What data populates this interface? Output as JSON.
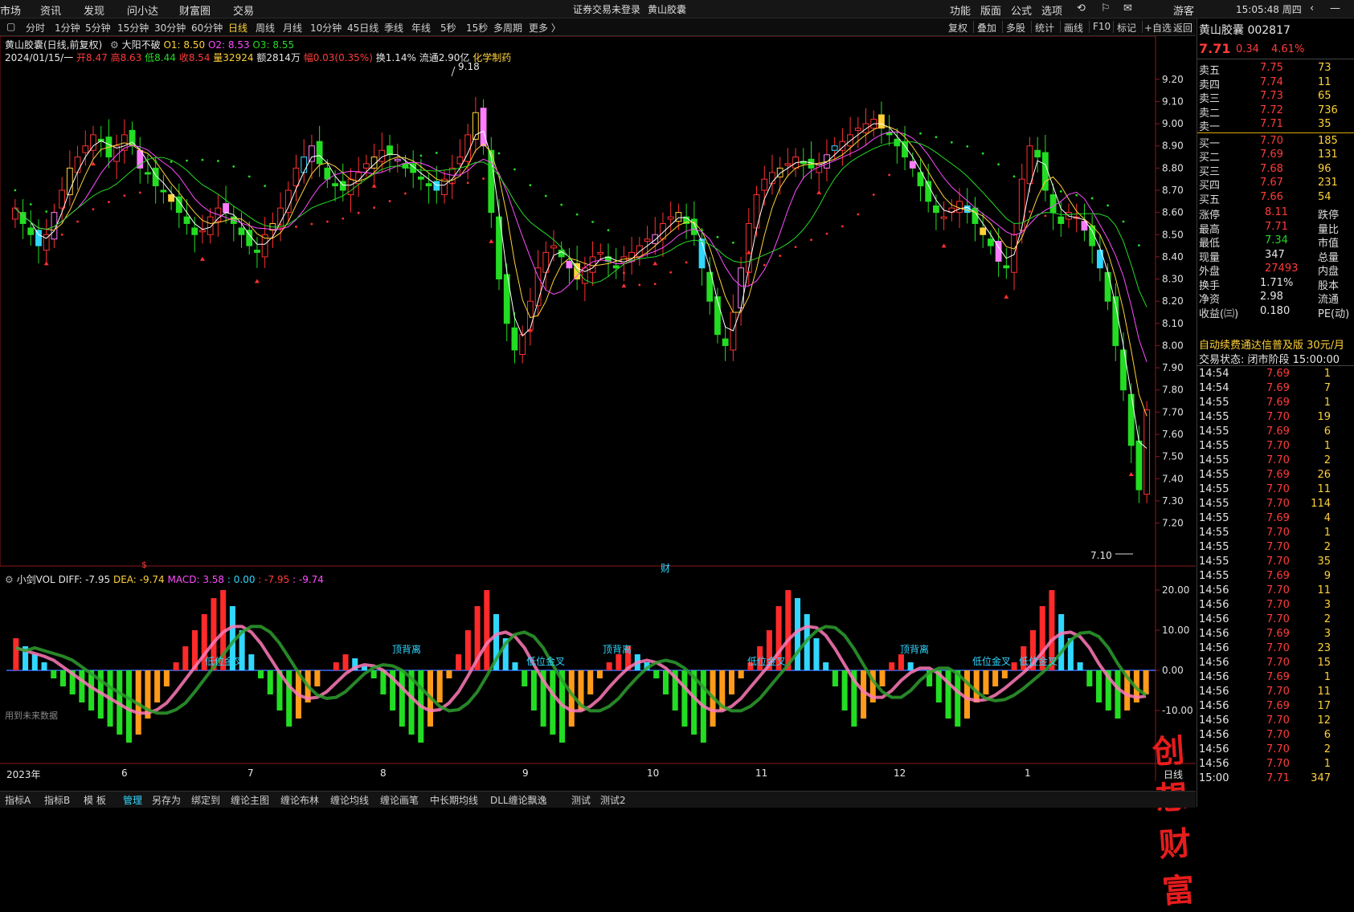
{
  "menu": {
    "items": [
      "市场",
      "资讯",
      "发现",
      "问小达",
      "财富圈",
      "交易"
    ],
    "notice": "证券交易未登录",
    "stock_link": "黄山胶囊",
    "right_items": [
      "功能",
      "版面",
      "公式",
      "选项"
    ],
    "guest": "游客",
    "clock": "15:05:48 周四"
  },
  "toolbar": {
    "periods": [
      "分时",
      "1分钟",
      "5分钟",
      "15分钟",
      "30分钟",
      "60分钟",
      "日线",
      "周线",
      "月线",
      "10分钟",
      "45日线",
      "季线",
      "年线",
      "5秒",
      "15秒",
      "多周期",
      "更多 〉"
    ],
    "active": "日线",
    "right": [
      "复权",
      "叠加",
      "多股",
      "统计",
      "画线",
      "F10",
      "标记",
      "+自选",
      "返回"
    ]
  },
  "main": {
    "title": "黄山胶囊(日线,前复权)",
    "indicator_name": "大阳不破",
    "o1": "O1: 8.50",
    "o2": "O2: 8.53",
    "o3": "O3: 8.55",
    "date": "2024/01/15/一",
    "open": "开8.47",
    "high": "高8.63",
    "low": "低8.44",
    "close": "收8.54",
    "vol": "量32924",
    "amount": "额2814万",
    "change": "幅0.03(0.35%)",
    "turnover": "换1.14%",
    "float": "流通2.90亿",
    "sector": "化学制药",
    "peak_label": "9.18",
    "low_label": "7.10",
    "cai_label": "财",
    "s_label": "$"
  },
  "sub": {
    "name": "小剑VOL",
    "diff": "DIFF: -7.95",
    "dea": "DEA: -9.74",
    "macd": "MACD: 3.58",
    "v1": ": 0.00",
    "v2": ": -7.95",
    "v3": ": -9.74",
    "note": "用到未来数据",
    "labels": {
      "l1": "低位金叉",
      "l2": "顶背离",
      "l3": "低位金叉",
      "l4": "顶背离",
      "l5": "低位金叉",
      "l6": "顶背离",
      "l7": "低位金叉",
      "l8": "低位金叉"
    }
  },
  "xaxis": {
    "ticks": [
      "2023年",
      "6",
      "7",
      "8",
      "9",
      "10",
      "11",
      "12",
      "1"
    ],
    "period": "日线"
  },
  "chart_data": {
    "type": "candlestick",
    "price_axis": {
      "ticks": [
        "9.20",
        "9.10",
        "9.00",
        "8.90",
        "8.80",
        "8.70",
        "8.60",
        "8.50",
        "8.40",
        "8.30",
        "8.20",
        "8.10",
        "8.00",
        "7.90",
        "7.80",
        "7.70",
        "7.60",
        "7.50",
        "7.40",
        "7.30",
        "7.20"
      ],
      "range": [
        7.05,
        9.25
      ]
    },
    "macd_axis": {
      "ticks": [
        "20.00",
        "10.00",
        "0.00",
        "-10.00"
      ],
      "range": [
        -20,
        22
      ]
    },
    "closes": [
      8.62,
      8.55,
      8.5,
      8.45,
      8.5,
      8.6,
      8.7,
      8.8,
      8.85,
      8.9,
      8.95,
      8.92,
      8.85,
      8.9,
      8.95,
      8.9,
      8.8,
      8.78,
      8.72,
      8.7,
      8.65,
      8.6,
      8.55,
      8.5,
      8.52,
      8.58,
      8.62,
      8.6,
      8.55,
      8.5,
      8.45,
      8.42,
      8.5,
      8.55,
      8.62,
      8.7,
      8.8,
      8.85,
      8.9,
      8.82,
      8.75,
      8.72,
      8.7,
      8.75,
      8.78,
      8.82,
      8.85,
      8.88,
      8.86,
      8.84,
      8.8,
      8.78,
      8.75,
      8.72,
      8.7,
      8.75,
      8.8,
      8.85,
      8.95,
      9.05,
      8.9,
      8.6,
      8.3,
      8.1,
      7.98,
      8.05,
      8.2,
      8.35,
      8.42,
      8.45,
      8.4,
      8.35,
      8.3,
      8.35,
      8.4,
      8.42,
      8.38,
      8.35,
      8.4,
      8.42,
      8.45,
      8.48,
      8.5,
      8.55,
      8.58,
      8.6,
      8.55,
      8.5,
      8.35,
      8.2,
      8.05,
      8.0,
      8.15,
      8.35,
      8.55,
      8.68,
      8.75,
      8.78,
      8.8,
      8.82,
      8.85,
      8.82,
      8.8,
      8.82,
      8.86,
      8.9,
      8.92,
      8.95,
      8.98,
      9.0,
      9.02,
      8.98,
      8.95,
      8.9,
      8.85,
      8.8,
      8.72,
      8.65,
      8.6,
      8.58,
      8.62,
      8.65,
      8.6,
      8.55,
      8.5,
      8.45,
      8.38,
      8.35,
      8.5,
      8.75,
      8.9,
      8.85,
      8.7,
      8.6,
      8.55,
      8.6,
      8.58,
      8.52,
      8.45,
      8.35,
      8.2,
      8.0,
      7.8,
      7.55,
      7.35,
      7.71
    ],
    "macd_hist": [
      8,
      6,
      4,
      2,
      -2,
      -4,
      -6,
      -8,
      -10,
      -12,
      -14,
      -16,
      -18,
      -16,
      -12,
      -8,
      -4,
      2,
      6,
      10,
      14,
      18,
      20,
      16,
      10,
      4,
      -2,
      -6,
      -10,
      -14,
      -12,
      -8,
      -4,
      0,
      2,
      4,
      3,
      1,
      -2,
      -6,
      -10,
      -14,
      -16,
      -18,
      -14,
      -8,
      -2,
      4,
      10,
      16,
      20,
      14,
      8,
      2,
      -4,
      -10,
      -14,
      -16,
      -18,
      -14,
      -10,
      -6,
      -2,
      2,
      4,
      6,
      4,
      2,
      -2,
      -6,
      -10,
      -14,
      -16,
      -18,
      -14,
      -10,
      -6,
      -2,
      2,
      6,
      10,
      16,
      20,
      18,
      14,
      8,
      2,
      -4,
      -10,
      -14,
      -12,
      -8,
      -4,
      2,
      4,
      2,
      0,
      -4,
      -8,
      -12,
      -14,
      -12,
      -8,
      -6,
      -4,
      -2,
      2,
      6,
      10,
      16,
      20,
      14,
      8,
      2,
      -4,
      -8,
      -10,
      -12,
      -10,
      -8,
      -6
    ]
  },
  "right": {
    "title": "黄山胶囊 002817",
    "price": "7.71",
    "chg": "0.34",
    "pct": "4.61%",
    "asks": [
      {
        "l": "卖五",
        "p": "7.75",
        "v": "73"
      },
      {
        "l": "卖四",
        "p": "7.74",
        "v": "11"
      },
      {
        "l": "卖三",
        "p": "7.73",
        "v": "65"
      },
      {
        "l": "卖二",
        "p": "7.72",
        "v": "736"
      },
      {
        "l": "卖一",
        "p": "7.71",
        "v": "35"
      }
    ],
    "bids": [
      {
        "l": "买一",
        "p": "7.70",
        "v": "185"
      },
      {
        "l": "买二",
        "p": "7.69",
        "v": "131"
      },
      {
        "l": "买三",
        "p": "7.68",
        "v": "96"
      },
      {
        "l": "买四",
        "p": "7.67",
        "v": "231"
      },
      {
        "l": "买五",
        "p": "7.66",
        "v": "54"
      }
    ],
    "stats": [
      {
        "a": "涨停",
        "b": "8.11",
        "c": "跌停"
      },
      {
        "a": "最高",
        "b": "7.71",
        "c": "量比"
      },
      {
        "a": "最低",
        "b": "7.34",
        "c": "市值"
      },
      {
        "a": "现量",
        "b": "347",
        "c": "总量"
      },
      {
        "a": "外盘",
        "b": "27493",
        "c": "内盘"
      },
      {
        "a": "换手",
        "b": "1.71%",
        "c": "股本"
      },
      {
        "a": "净资",
        "b": "2.98",
        "c": "流通"
      },
      {
        "a": "收益(㈢)",
        "b": "0.180",
        "c": "PE(动)"
      }
    ],
    "promo": "自动续费通达信普及版  30元/月",
    "state": "交易状态: 闭市阶段 15:00:00",
    "ticks": [
      {
        "t": "14:54",
        "p": "7.69",
        "v": "1"
      },
      {
        "t": "14:54",
        "p": "7.69",
        "v": "7"
      },
      {
        "t": "14:55",
        "p": "7.69",
        "v": "1"
      },
      {
        "t": "14:55",
        "p": "7.70",
        "v": "19"
      },
      {
        "t": "14:55",
        "p": "7.69",
        "v": "6"
      },
      {
        "t": "14:55",
        "p": "7.70",
        "v": "1"
      },
      {
        "t": "14:55",
        "p": "7.70",
        "v": "2"
      },
      {
        "t": "14:55",
        "p": "7.69",
        "v": "26"
      },
      {
        "t": "14:55",
        "p": "7.70",
        "v": "11"
      },
      {
        "t": "14:55",
        "p": "7.70",
        "v": "114"
      },
      {
        "t": "14:55",
        "p": "7.69",
        "v": "4"
      },
      {
        "t": "14:55",
        "p": "7.70",
        "v": "1"
      },
      {
        "t": "14:55",
        "p": "7.70",
        "v": "2"
      },
      {
        "t": "14:55",
        "p": "7.70",
        "v": "35"
      },
      {
        "t": "14:55",
        "p": "7.69",
        "v": "9"
      },
      {
        "t": "14:56",
        "p": "7.70",
        "v": "11"
      },
      {
        "t": "14:56",
        "p": "7.70",
        "v": "3"
      },
      {
        "t": "14:56",
        "p": "7.70",
        "v": "2"
      },
      {
        "t": "14:56",
        "p": "7.69",
        "v": "3"
      },
      {
        "t": "14:56",
        "p": "7.70",
        "v": "23"
      },
      {
        "t": "14:56",
        "p": "7.70",
        "v": "15"
      },
      {
        "t": "14:56",
        "p": "7.69",
        "v": "1"
      },
      {
        "t": "14:56",
        "p": "7.70",
        "v": "11"
      },
      {
        "t": "14:56",
        "p": "7.69",
        "v": "17"
      },
      {
        "t": "14:56",
        "p": "7.70",
        "v": "12"
      },
      {
        "t": "14:56",
        "p": "7.70",
        "v": "6"
      },
      {
        "t": "14:56",
        "p": "7.70",
        "v": "2"
      },
      {
        "t": "14:56",
        "p": "7.70",
        "v": "1"
      },
      {
        "t": "15:00",
        "p": "7.71",
        "v": "347"
      }
    ]
  },
  "bottom": {
    "tabs": [
      "指标A",
      "指标B",
      "模 板",
      "管理",
      "另存为",
      "绑定到",
      "缠论主图",
      "缠论布林",
      "缠论均线",
      "缠论画笔",
      "中长期均线",
      "DLL缠论飘逸",
      "测试",
      "测试2"
    ],
    "active": "管理"
  },
  "watermark": {
    "text": "创想财富"
  },
  "colors": {
    "up": "#ff3b3b",
    "down": "#26d926",
    "accent": "#ffd23a"
  }
}
